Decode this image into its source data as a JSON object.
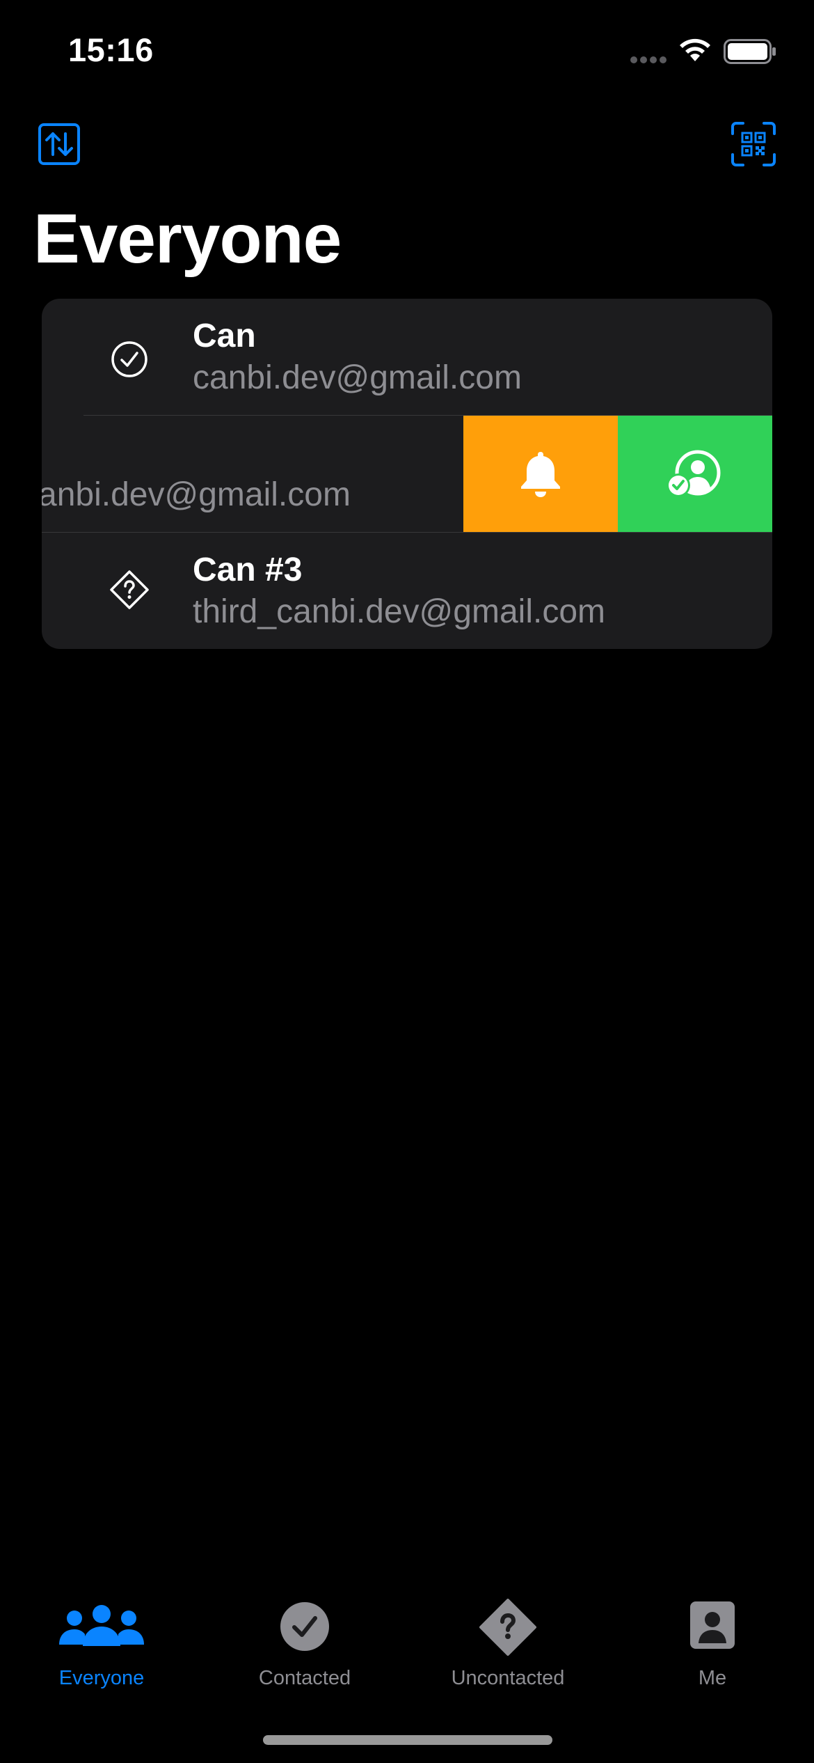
{
  "status_bar": {
    "time": "15:16"
  },
  "header": {
    "title": "Everyone",
    "left_button_icon": "sort-arrows-icon",
    "right_button_icon": "qr-code-scan-icon"
  },
  "contacts": [
    {
      "name": "Can",
      "email": "canbi.dev@gmail.com",
      "status_icon": "checkmark-circle-icon"
    },
    {
      "email_partial": "anbi.dev@gmail.com"
    },
    {
      "name": "Can #3",
      "email": "third_canbi.dev@gmail.com",
      "status_icon": "question-diamond-icon"
    }
  ],
  "swipe_actions": [
    {
      "icon": "bell-icon",
      "color": "#ff9f0a"
    },
    {
      "icon": "person-check-icon",
      "color": "#30d158"
    }
  ],
  "tabs": [
    {
      "label": "Everyone",
      "icon": "people-icon",
      "active": true
    },
    {
      "label": "Contacted",
      "icon": "checkmark-circle-filled-icon",
      "active": false
    },
    {
      "label": "Uncontacted",
      "icon": "question-diamond-filled-icon",
      "active": false
    },
    {
      "label": "Me",
      "icon": "person-square-icon",
      "active": false
    }
  ],
  "colors": {
    "accent": "#0a84ff",
    "background": "#000000",
    "card": "#1c1c1e",
    "secondary_text": "#8e8e93"
  }
}
